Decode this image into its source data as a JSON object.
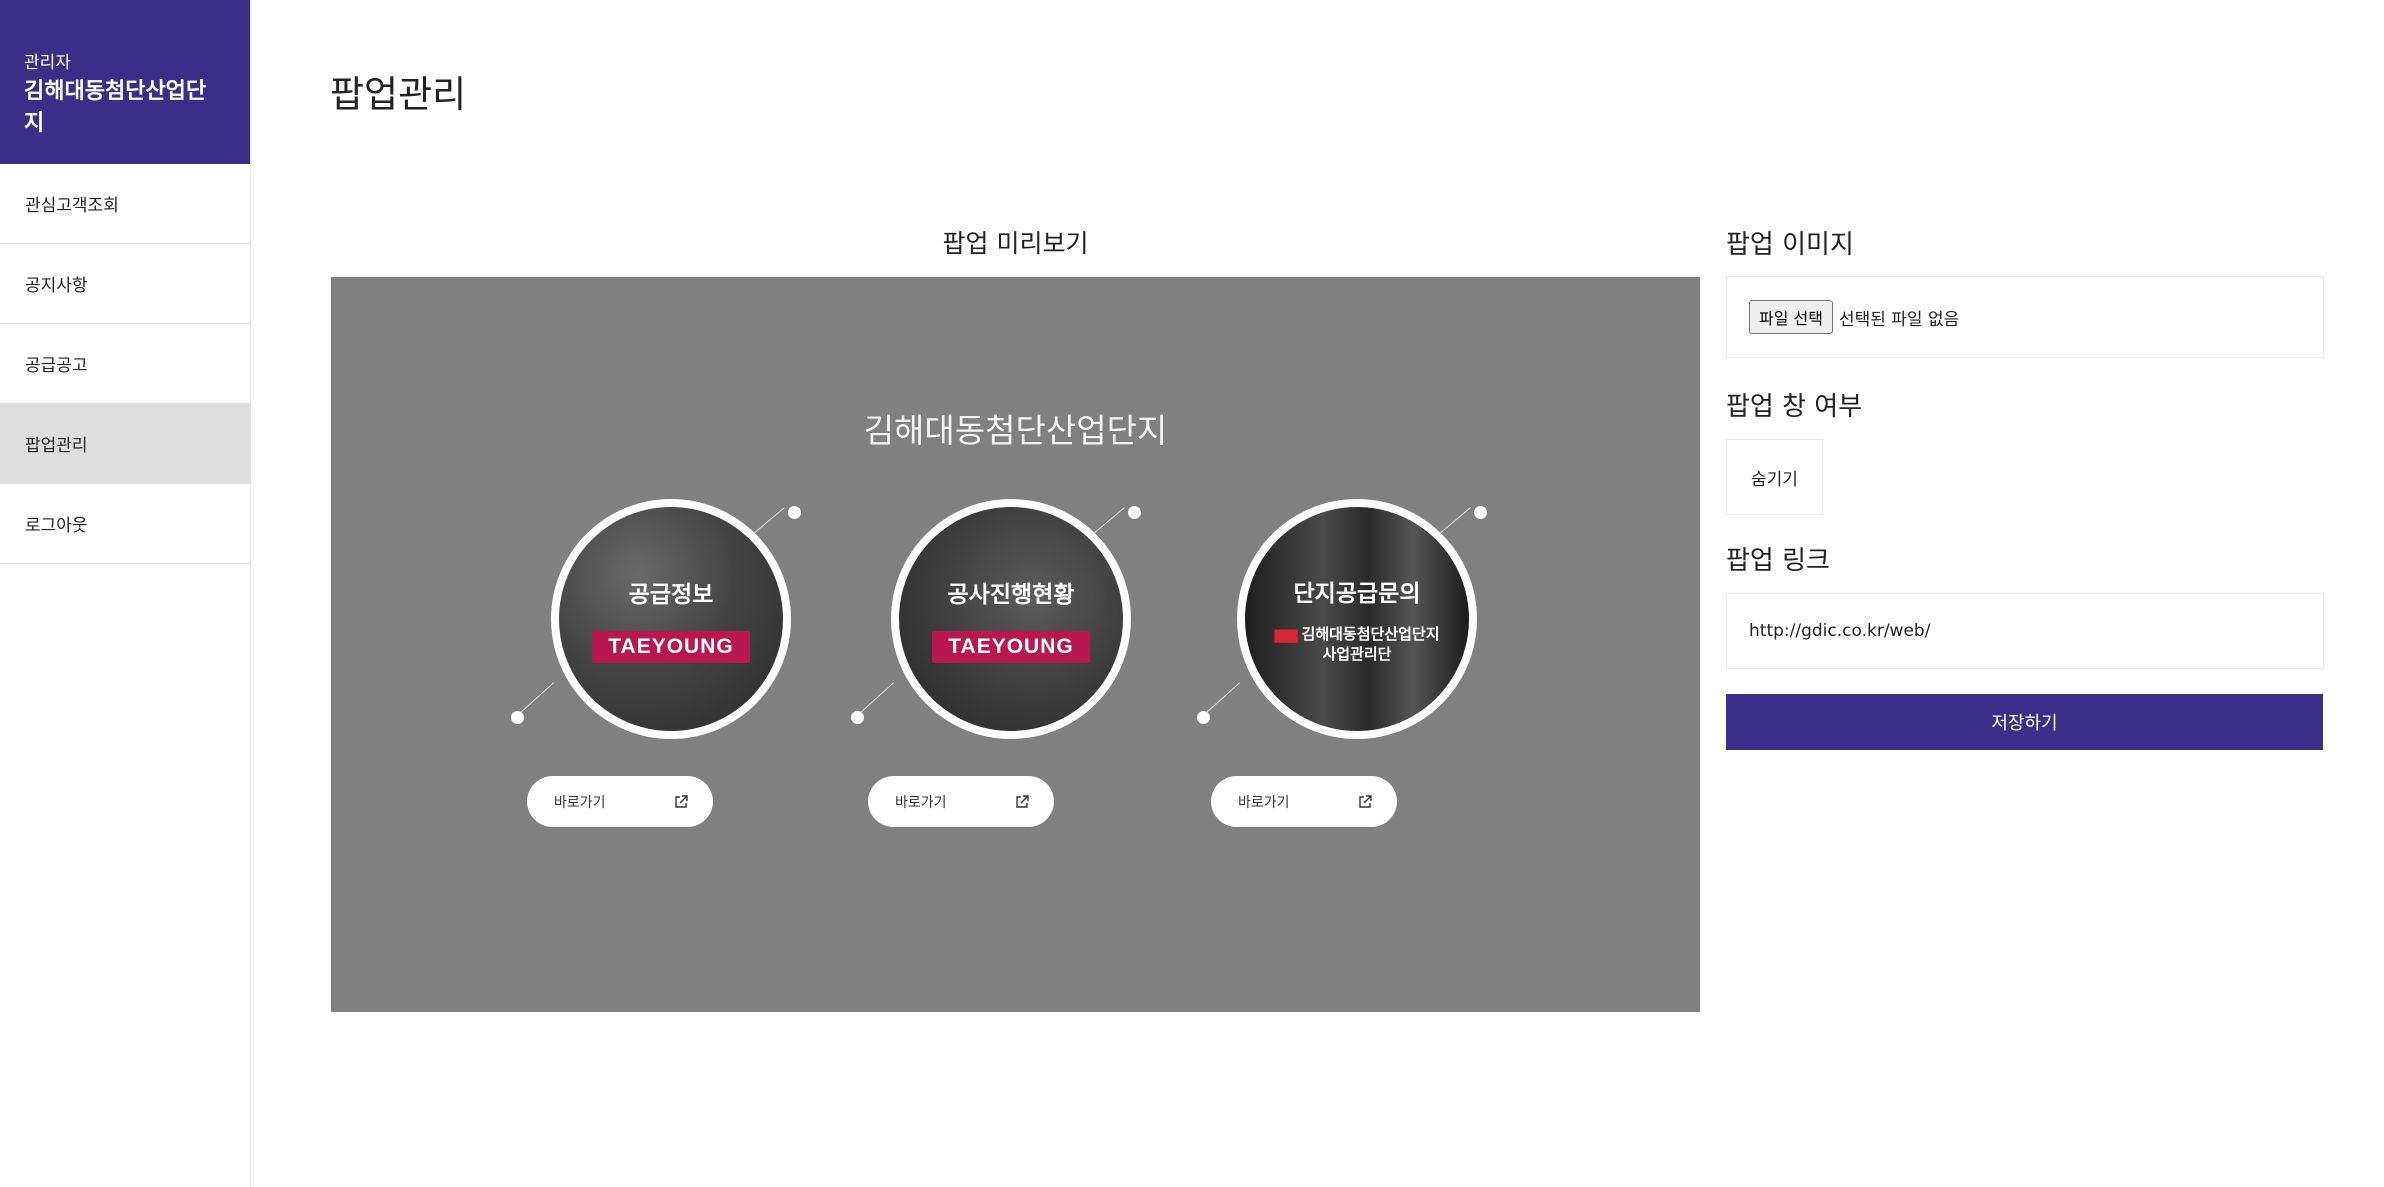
{
  "sidebar": {
    "brand_sub": "관리자",
    "brand_name": "김해대동첨단산업단지",
    "items": [
      {
        "label": "관심고객조회"
      },
      {
        "label": "공지사항"
      },
      {
        "label": "공급공고"
      },
      {
        "label": "팝업관리",
        "active": true
      },
      {
        "label": "로그아웃"
      }
    ]
  },
  "main": {
    "title": "팝업관리",
    "preview": {
      "title": "팝업 미리보기",
      "popup_heading": "김해대동첨단산업단지",
      "cards": [
        {
          "title": "공급정보",
          "badge": "TAEYOUNG",
          "button": "바로가기",
          "icon": "external-link-icon"
        },
        {
          "title": "공사진행현황",
          "badge": "TAEYOUNG",
          "button": "바로가기",
          "icon": "external-link-icon"
        },
        {
          "title": "단지공급문의",
          "org_line1": "김해대동첨단산업단지",
          "org_line2": "사업관리단",
          "org_mark": "▆▆",
          "button": "바로가기",
          "icon": "external-link-icon"
        }
      ]
    },
    "form": {
      "image_label": "팝업 이미지",
      "file_button": "파일 선택",
      "file_status": "선택된 파일 없음",
      "visibility_label": "팝업 창 여부",
      "visibility_value": "숨기기",
      "link_label": "팝업 링크",
      "link_value": "http://gdic.co.kr/web/",
      "save_button": "저장하기"
    }
  },
  "colors": {
    "brand": "#3a2e86",
    "preview_bg": "#808080",
    "badge": "#b8174f",
    "active_nav": "#dedede"
  }
}
